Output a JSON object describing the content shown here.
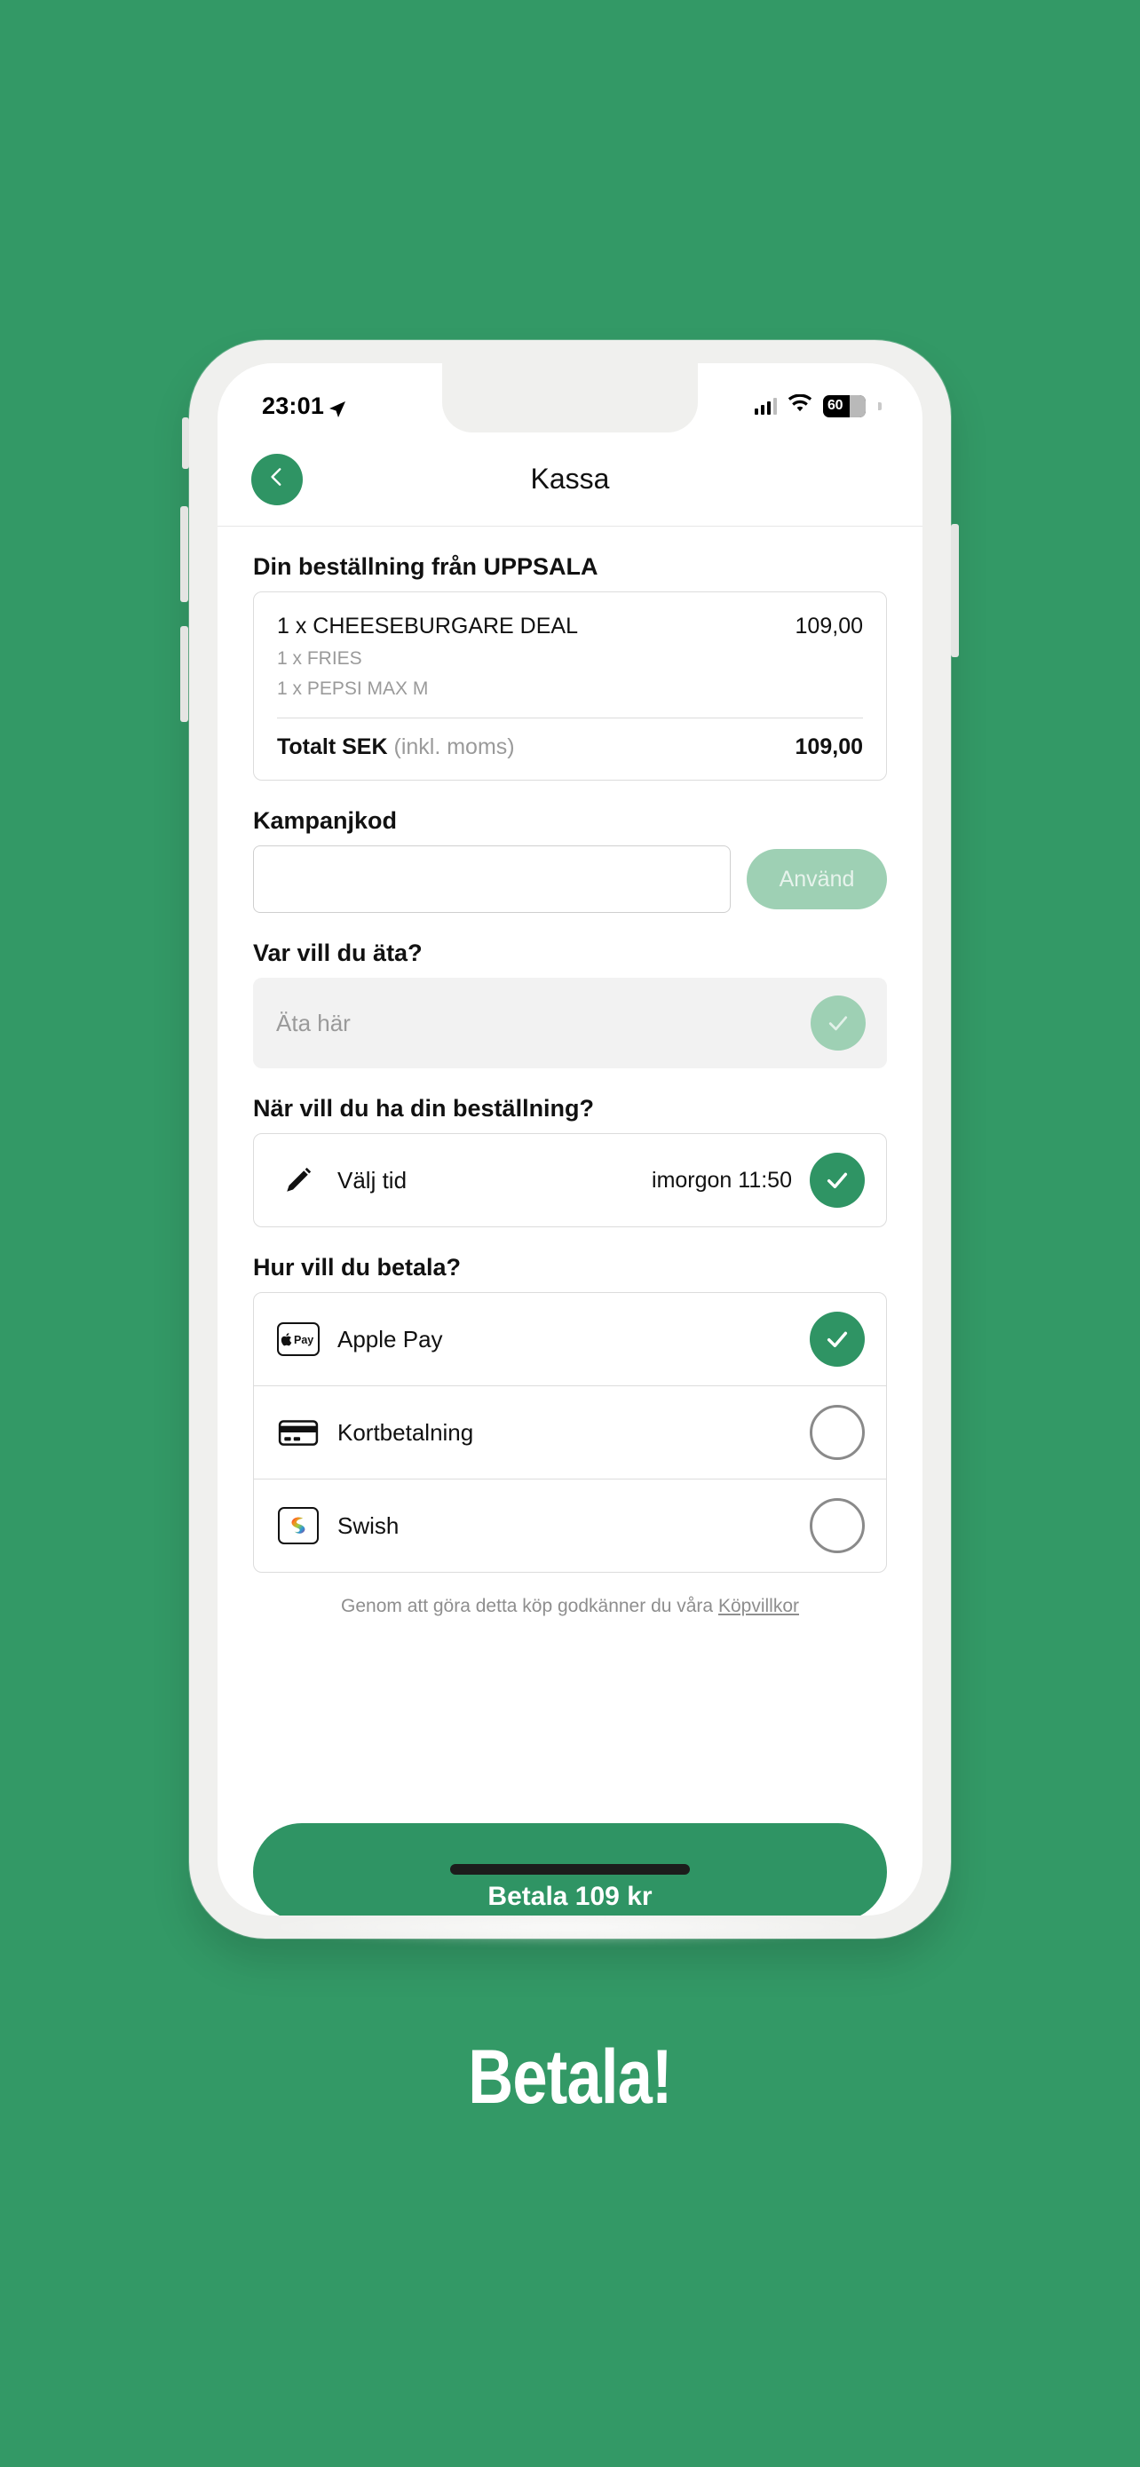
{
  "background_color": "#339966",
  "brand_green": "#2f9464",
  "caption": "Betala!",
  "statusbar": {
    "time": "23:01",
    "location_icon": "location-arrow-icon",
    "signal_icon": "cellular-signal-icon",
    "wifi_icon": "wifi-icon",
    "battery_level": "60"
  },
  "navbar": {
    "back_icon": "chevron-left-icon",
    "title": "Kassa"
  },
  "order": {
    "heading": "Din beställning från UPPSALA",
    "items": [
      {
        "name": "1 x CHEESEBURGARE DEAL",
        "price": "109,00",
        "sub_items": [
          "1 x FRIES",
          "1 x PEPSI MAX M"
        ]
      }
    ],
    "total_label": "Totalt SEK",
    "total_vat_note": "(inkl. moms)",
    "total_amount": "109,00"
  },
  "promo": {
    "label": "Kampanjkod",
    "input_value": "",
    "input_placeholder": "",
    "apply_label": "Använd"
  },
  "eat_location": {
    "heading": "Var vill du äta?",
    "option_label": "Äta här",
    "check_icon": "check-icon"
  },
  "pickup_time": {
    "heading": "När vill du ha din beställning?",
    "pencil_icon": "pencil-icon",
    "label": "Välj tid",
    "value": "imorgon 11:50",
    "check_icon": "check-icon"
  },
  "payment": {
    "heading": "Hur vill du betala?",
    "methods": [
      {
        "label": "Apple Pay",
        "icon": "apple-pay-icon",
        "selected": true
      },
      {
        "label": "Kortbetalning",
        "icon": "credit-card-icon",
        "selected": false
      },
      {
        "label": "Swish",
        "icon": "swish-icon",
        "selected": false
      }
    ]
  },
  "terms": {
    "text": "Genom att göra detta köp godkänner du våra ",
    "link_label": "Köpvillkor"
  },
  "pay_button": {
    "label": "Betala 109 kr"
  }
}
